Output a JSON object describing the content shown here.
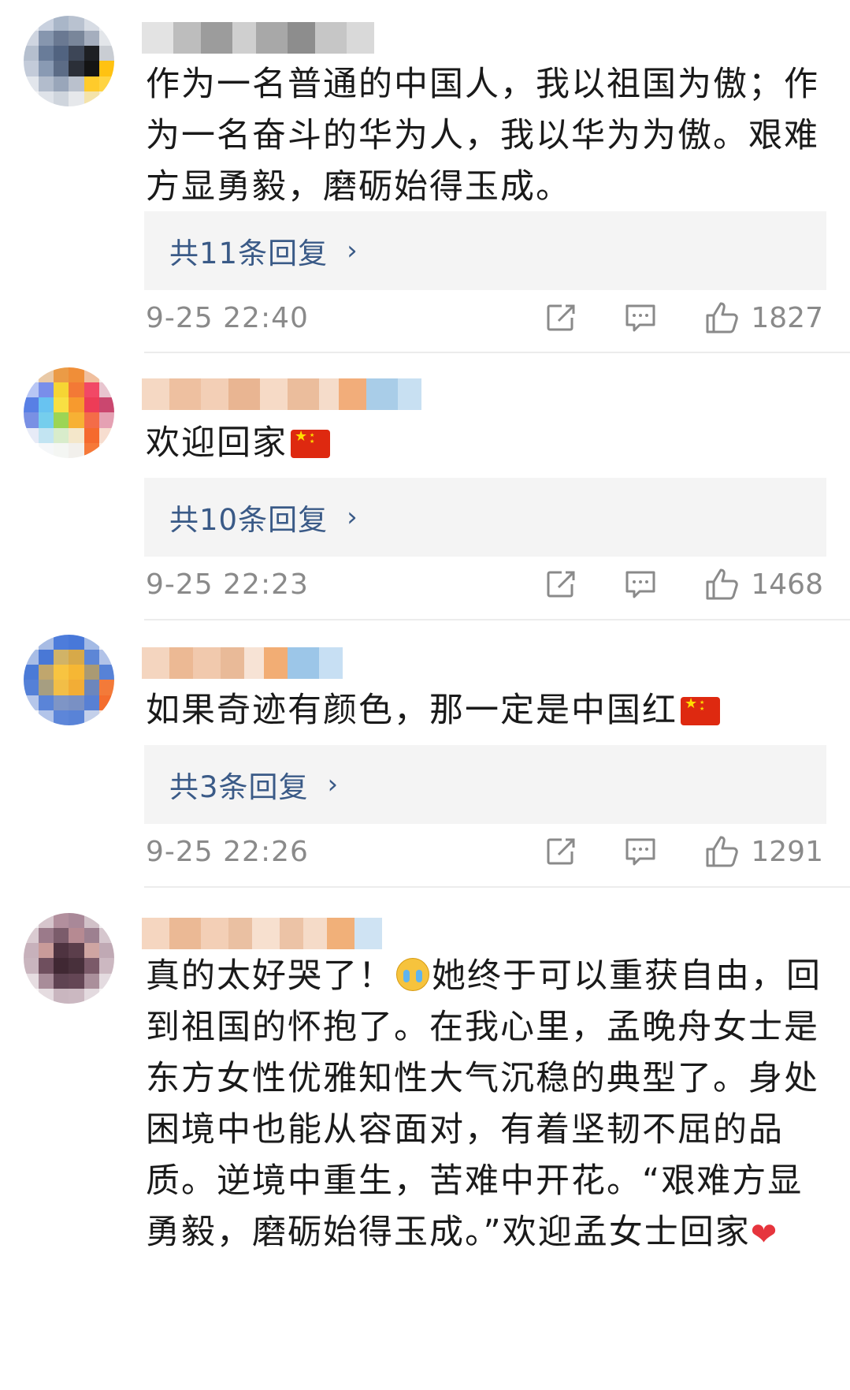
{
  "comments": [
    {
      "text": "作为一名普通的中国人，我以祖国为傲；作为一名奋斗的华为人，我以华为为傲。艰难方显勇毅，磨砺始得玉成。",
      "replies_label": "共11条回复",
      "time": "9-25 22:40",
      "likes": "1827"
    },
    {
      "text": "欢迎回家",
      "replies_label": "共10条回复",
      "time": "9-25 22:23",
      "likes": "1468"
    },
    {
      "text": "如果奇迹有颜色，那一定是中国红",
      "replies_label": "共3条回复",
      "time": "9-25 22:26",
      "likes": "1291"
    },
    {
      "text_a": "真的太好哭了！",
      "text_b": "她终于可以重获自由，回到祖国的怀抱了。在我心里，孟晚舟女士是东方女性优雅知性大气沉稳的典型了。身处困境中也能从容面对，有着坚韧不屈的品质。逆境中重生，苦难中开花。“艰难方显勇毅，磨砺始得玉成。”欢迎孟女士回家"
    }
  ],
  "icons": {
    "share": "share-icon",
    "comment": "comment-icon",
    "like": "thumbs-up-icon",
    "china_flag": "china-flag-emoji",
    "crying": "crying-face-emoji",
    "heart": "red-heart-emoji",
    "chevron": "chevron-right-icon"
  },
  "colors": {
    "reply_link": "#3a5a87",
    "reply_bg": "#f4f4f4",
    "meta_text": "#8a8a8a",
    "flag_red": "#de2910",
    "heart_red": "#e6353d"
  }
}
